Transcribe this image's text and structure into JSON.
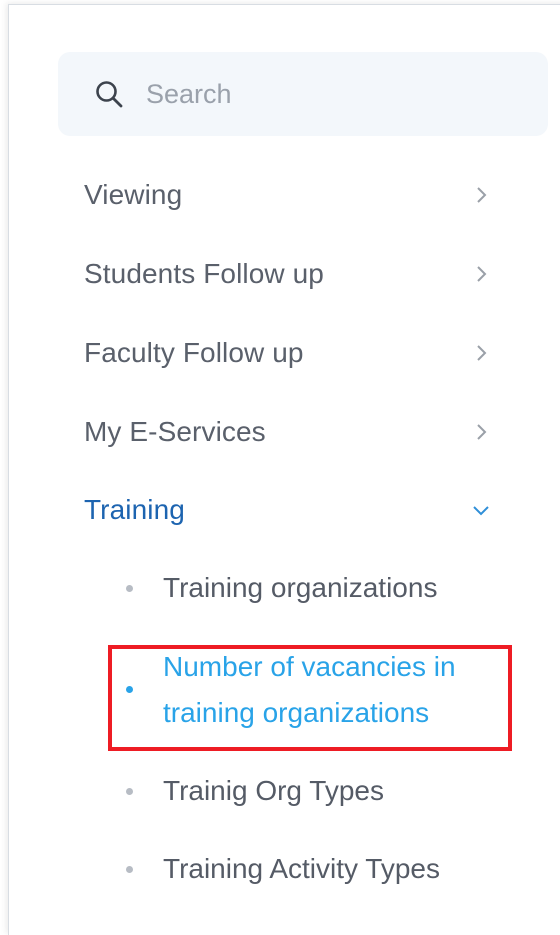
{
  "search": {
    "placeholder": "Search",
    "icon": "search-icon"
  },
  "nav": {
    "items": [
      {
        "label": "Viewing",
        "icon": "chevron-right-icon"
      },
      {
        "label": "Students Follow up",
        "icon": "chevron-right-icon"
      },
      {
        "label": "Faculty Follow up",
        "icon": "chevron-right-icon"
      },
      {
        "label": "My E-Services",
        "icon": "chevron-right-icon"
      },
      {
        "label": "Training",
        "icon": "chevron-down-icon",
        "expanded": true
      }
    ],
    "training_sub_items": [
      {
        "label": "Training organizations",
        "selected": false
      },
      {
        "label": "Number of vacancies in training organizations",
        "selected": true
      },
      {
        "label": "Trainig Org Types",
        "selected": false
      },
      {
        "label": "Training Activity Types",
        "selected": false
      }
    ]
  },
  "colors": {
    "active_section": "#1d64b0",
    "selected_item": "#29a3e8",
    "highlight_border": "#ee1c24",
    "text": "#5a606b",
    "search_bg": "#f3f7fb"
  }
}
